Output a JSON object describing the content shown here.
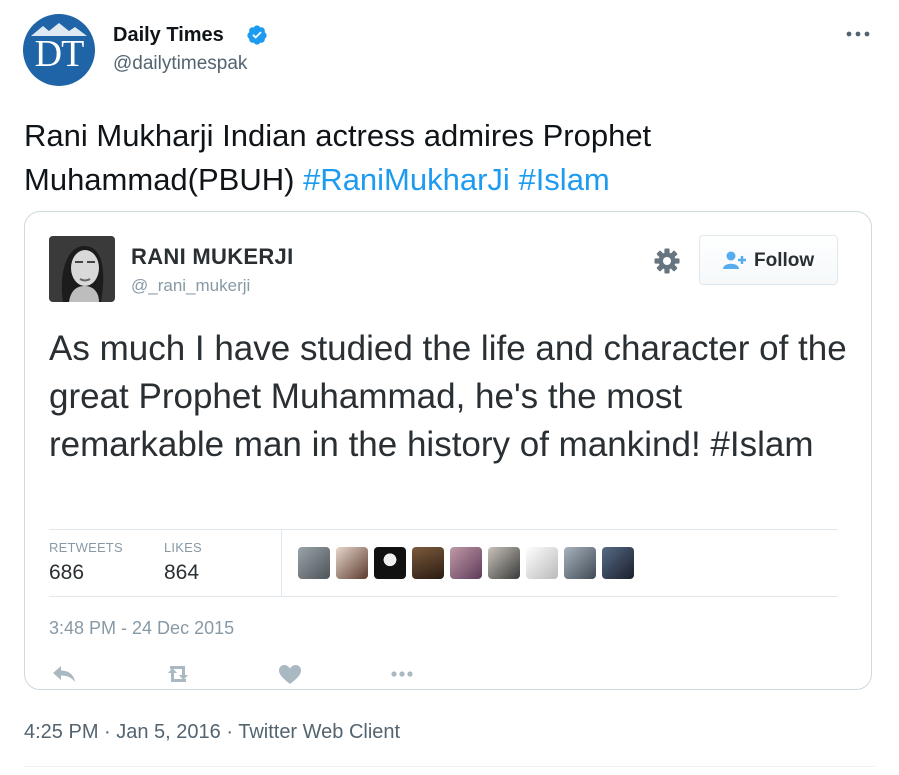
{
  "author": {
    "avatar_text": "DT",
    "display_name": "Daily Times",
    "handle": "@dailytimespak",
    "verified": true
  },
  "tweet": {
    "text_plain": "Rani Mukharji Indian actress admires Prophet Muhammad(PBUH) ",
    "hashtags": [
      "#RaniMukharJi",
      "#Islam"
    ]
  },
  "quoted": {
    "display_name": "RANI MUKERJI",
    "handle": "@_rani_mukerji",
    "follow_label": "Follow",
    "text": "As much I have studied the life and character of the great Prophet Muhammad, he's the most remarkable man in the history of mankind! #Islam",
    "stats": {
      "retweets_label": "RETWEETS",
      "retweets_value": "686",
      "likes_label": "LIKES",
      "likes_value": "864"
    },
    "date": "3:48 PM - 24 Dec 2015"
  },
  "footer": {
    "meta": "4:25 PM · Jan 5, 2016 · Twitter Web Client"
  },
  "colors": {
    "accent": "#1d9bf0",
    "text_primary": "#0f1419",
    "text_secondary": "#536471",
    "border": "#cfd9de",
    "dt_blue": "#1f64a6"
  },
  "icons": {
    "verified": "verified-badge-icon",
    "more": "more-horizontal-icon",
    "gear": "gear-icon",
    "follow": "add-user-icon",
    "reply": "reply-icon",
    "retweet": "retweet-icon",
    "like": "heart-icon",
    "more_actions": "more-dots-icon"
  }
}
